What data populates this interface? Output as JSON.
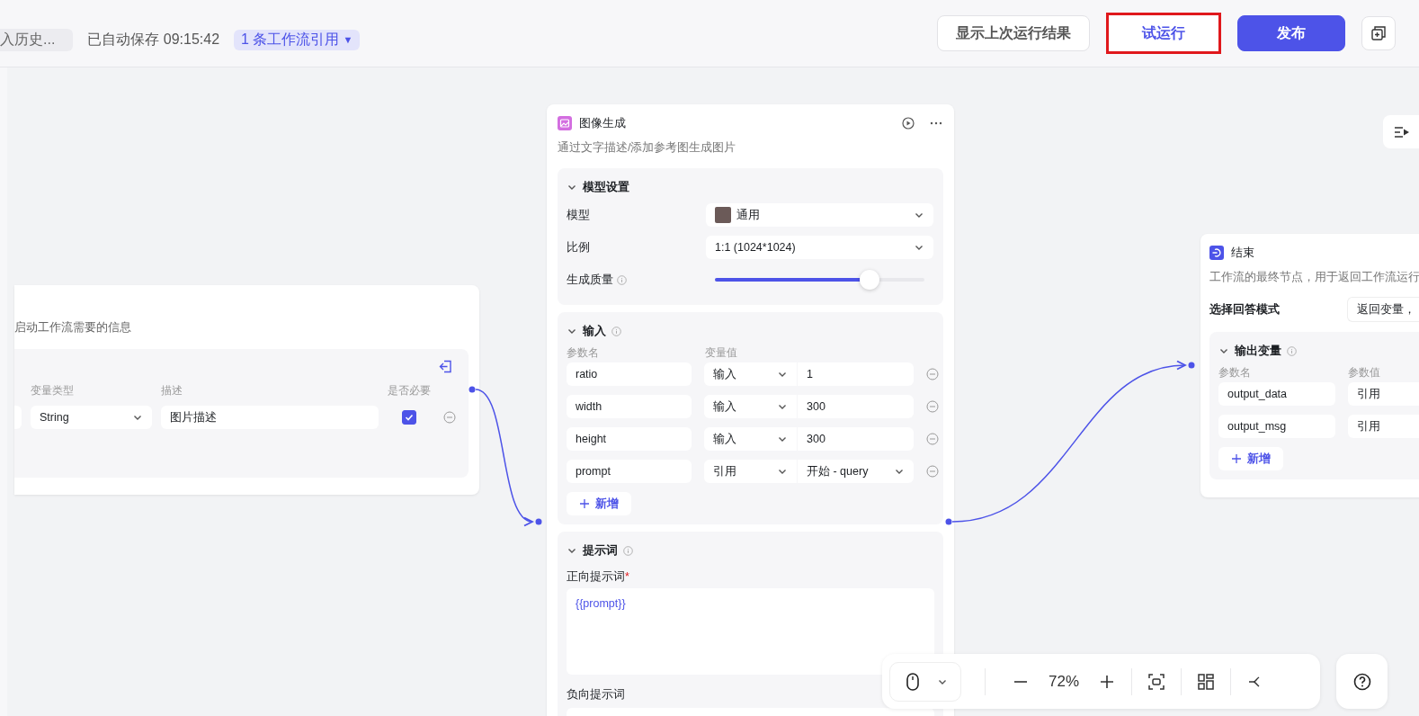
{
  "header": {
    "history_button": "入历史...",
    "autosave": "已自动保存 09:15:42",
    "references": "1 条工作流引用",
    "references_caret": "▼",
    "buttons": [
      {
        "label": "显示上次运行结果",
        "kind": "secondary",
        "highlighted": false
      },
      {
        "label": "试运行",
        "kind": "secondary",
        "highlighted": true
      },
      {
        "label": "发布",
        "kind": "primary",
        "highlighted": false
      }
    ]
  },
  "start_node": {
    "description": "启动工作流需要的信息",
    "columns": [
      "变量类型",
      "描述",
      "是否必要"
    ],
    "rows": [
      {
        "type": "String",
        "description": "图片描述",
        "required": true
      }
    ]
  },
  "image_node": {
    "title": "图像生成",
    "description": "通过文字描述/添加参考图生成图片",
    "model_settings": {
      "title": "模型设置",
      "expanded": true,
      "model_label": "模型",
      "model_value": "通用",
      "ratio_label": "比例",
      "ratio_value": "1:1 (1024*1024)",
      "quality": {
        "label": "生成质量",
        "level": 0.74
      }
    },
    "inputs": {
      "title": "输入",
      "expanded": true,
      "columns": [
        "参数名",
        "变量值"
      ],
      "rows": [
        {
          "name": "ratio",
          "source": "输入",
          "value": "1",
          "kind": "text"
        },
        {
          "name": "width",
          "source": "输入",
          "value": "300",
          "kind": "text"
        },
        {
          "name": "height",
          "source": "输入",
          "value": "300",
          "kind": "text"
        },
        {
          "name": "prompt",
          "source": "引用",
          "value": "开始 - query",
          "kind": "select"
        }
      ],
      "add_button": "新增"
    },
    "prompt": {
      "title": "提示词",
      "expanded": true,
      "positive_label": "正向提示词",
      "required_mark": "*",
      "positive_value": "{{prompt}}",
      "negative_label": "负向提示词"
    }
  },
  "end_node": {
    "title": "结束",
    "description": "工作流的最终节点，用于返回工作流运行",
    "mode_label": "选择回答模式",
    "mode_value": "返回变量，",
    "output": {
      "title": "输出变量",
      "expanded": true,
      "columns": [
        "参数名",
        "参数值"
      ],
      "rows": [
        {
          "name": "output_data",
          "source": "引用"
        },
        {
          "name": "output_msg",
          "source": "引用"
        }
      ],
      "add_button": "新增"
    }
  },
  "toolbar": {
    "zoom": "72%"
  }
}
